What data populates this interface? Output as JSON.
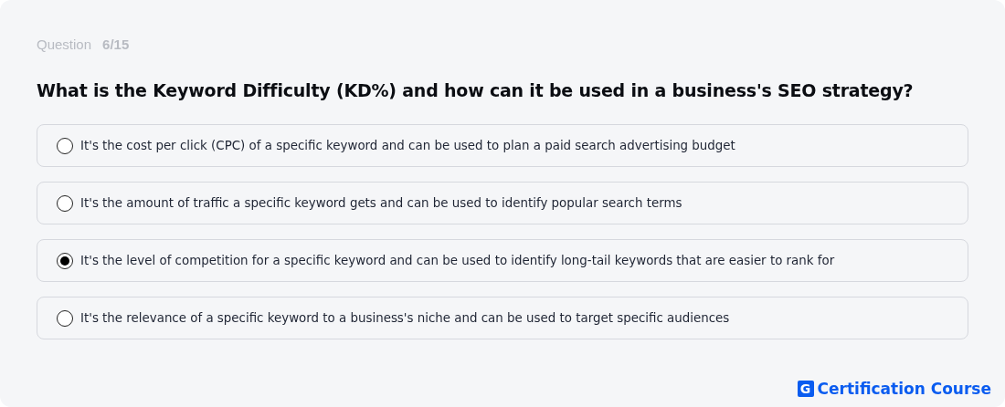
{
  "header": {
    "label": "Question",
    "counter": "6/15"
  },
  "question": "What is the Keyword Difficulty (KD%) and how can it be used in a business's SEO strategy?",
  "options": [
    {
      "text": "It's the cost per click (CPC) of a specific keyword and can be used to plan a paid search advertising budget",
      "selected": false
    },
    {
      "text": "It's the amount of traffic a specific keyword gets and can be used to identify popular search terms",
      "selected": false
    },
    {
      "text": "It's the level of competition for a specific keyword and can be used to identify long-tail keywords that are easier to rank for",
      "selected": true
    },
    {
      "text": "It's the relevance of a specific keyword to a business's niche and can be used to target specific audiences",
      "selected": false
    }
  ],
  "brand": {
    "mark": "G",
    "name": "Certification Course"
  }
}
